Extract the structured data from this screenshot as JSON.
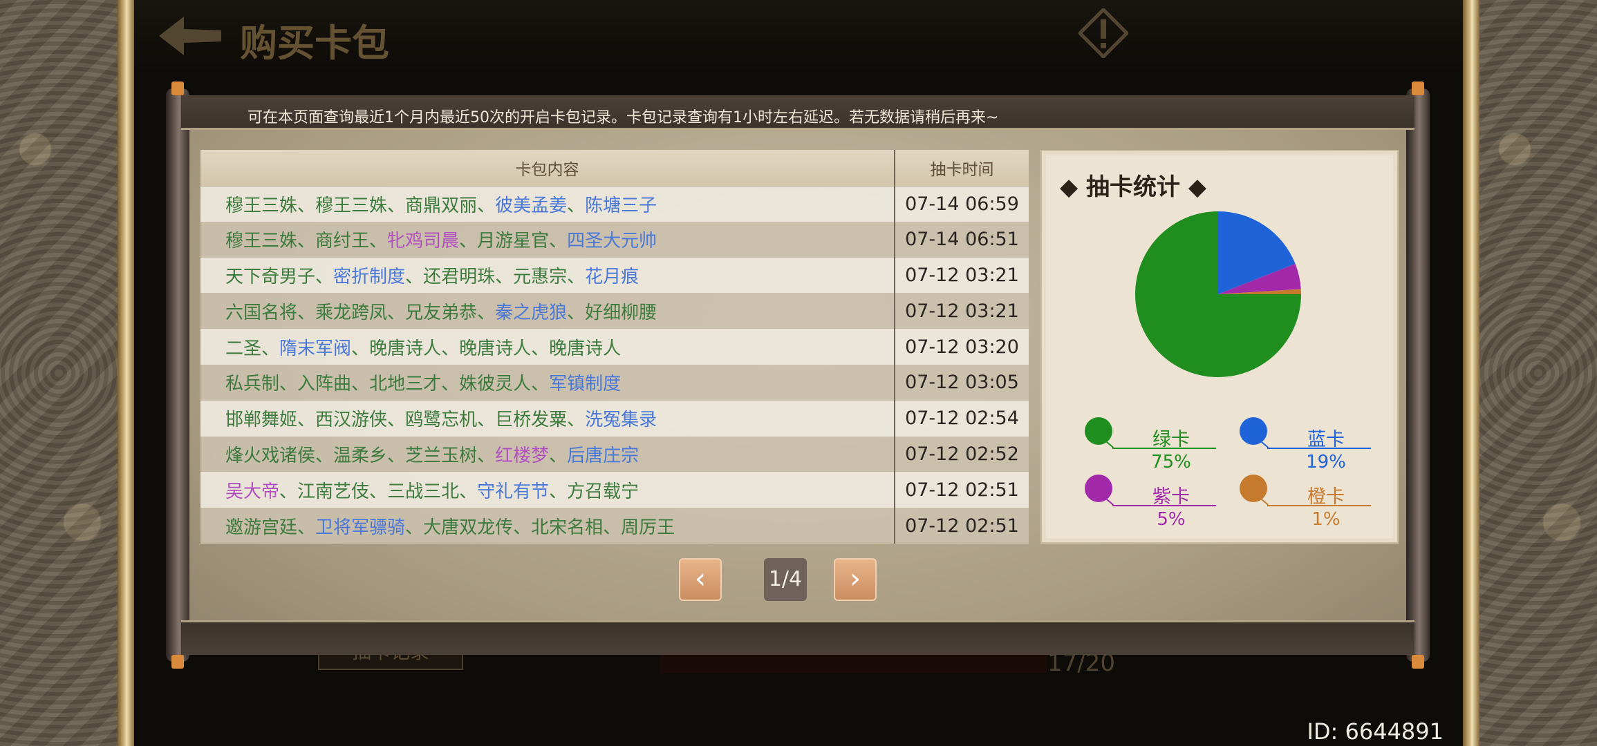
{
  "header": {
    "title": "购买卡包"
  },
  "notice": "可在本页面查询最近1个月内最近50次的开启卡包记录。卡包记录查询有1小时左右延迟。若无数据请稍后再来~",
  "table": {
    "col_content": "卡包内容",
    "col_time": "抽卡时间",
    "rows": [
      {
        "cards": [
          {
            "name": "穆王三姝",
            "color": "green"
          },
          {
            "name": "穆王三姝",
            "color": "green"
          },
          {
            "name": "商鼎双丽",
            "color": "green"
          },
          {
            "name": "彼美孟姜",
            "color": "blue"
          },
          {
            "name": "陈塘三子",
            "color": "blue"
          }
        ],
        "time": "07-14 06:59"
      },
      {
        "cards": [
          {
            "name": "穆王三姝",
            "color": "green"
          },
          {
            "name": "商纣王",
            "color": "green"
          },
          {
            "name": "牝鸡司晨",
            "color": "purple"
          },
          {
            "name": "月游星官",
            "color": "green"
          },
          {
            "name": "四圣大元帅",
            "color": "blue"
          }
        ],
        "time": "07-14 06:51"
      },
      {
        "cards": [
          {
            "name": "天下奇男子",
            "color": "green"
          },
          {
            "name": "密折制度",
            "color": "blue"
          },
          {
            "name": "还君明珠",
            "color": "green"
          },
          {
            "name": "元惠宗",
            "color": "green"
          },
          {
            "name": "花月痕",
            "color": "blue"
          }
        ],
        "time": "07-12 03:21"
      },
      {
        "cards": [
          {
            "name": "六国名将",
            "color": "green"
          },
          {
            "name": "乘龙跨凤",
            "color": "green"
          },
          {
            "name": "兄友弟恭",
            "color": "green"
          },
          {
            "name": "秦之虎狼",
            "color": "blue"
          },
          {
            "name": "好细柳腰",
            "color": "green"
          }
        ],
        "time": "07-12 03:21"
      },
      {
        "cards": [
          {
            "name": "二圣",
            "color": "green"
          },
          {
            "name": "隋末军阀",
            "color": "blue"
          },
          {
            "name": "晚唐诗人",
            "color": "green"
          },
          {
            "name": "晚唐诗人",
            "color": "green"
          },
          {
            "name": "晚唐诗人",
            "color": "green"
          }
        ],
        "time": "07-12 03:20"
      },
      {
        "cards": [
          {
            "name": "私兵制",
            "color": "green"
          },
          {
            "name": "入阵曲",
            "color": "green"
          },
          {
            "name": "北地三才",
            "color": "green"
          },
          {
            "name": "姝彼灵人",
            "color": "green"
          },
          {
            "name": "军镇制度",
            "color": "blue"
          }
        ],
        "time": "07-12 03:05"
      },
      {
        "cards": [
          {
            "name": "邯郸舞姬",
            "color": "green"
          },
          {
            "name": "西汉游侠",
            "color": "green"
          },
          {
            "name": "鸥鹭忘机",
            "color": "green"
          },
          {
            "name": "巨桥发粟",
            "color": "green"
          },
          {
            "name": "洗冤集录",
            "color": "blue"
          }
        ],
        "time": "07-12 02:54"
      },
      {
        "cards": [
          {
            "name": "烽火戏诸侯",
            "color": "green"
          },
          {
            "name": "温柔乡",
            "color": "green"
          },
          {
            "name": "芝兰玉树",
            "color": "green"
          },
          {
            "name": "红楼梦",
            "color": "purple"
          },
          {
            "name": "后唐庄宗",
            "color": "blue"
          }
        ],
        "time": "07-12 02:52"
      },
      {
        "cards": [
          {
            "name": "吴大帝",
            "color": "purple"
          },
          {
            "name": "江南艺伎",
            "color": "green"
          },
          {
            "name": "三战三北",
            "color": "green"
          },
          {
            "name": "守礼有节",
            "color": "blue"
          },
          {
            "name": "方召载宁",
            "color": "green"
          }
        ],
        "time": "07-12 02:51"
      },
      {
        "cards": [
          {
            "name": "邀游宫廷",
            "color": "green"
          },
          {
            "name": "卫将军骠骑",
            "color": "blue"
          },
          {
            "name": "大唐双龙传",
            "color": "green"
          },
          {
            "name": "北宋名相",
            "color": "green"
          },
          {
            "name": "周厉王",
            "color": "green"
          }
        ],
        "time": "07-12 02:51"
      }
    ]
  },
  "stats": {
    "title": "◆ 抽卡统计 ◆",
    "legend": [
      {
        "label": "绿卡",
        "pct": "75%",
        "color": "#1f8e1f"
      },
      {
        "label": "蓝卡",
        "pct": "19%",
        "color": "#1f63d8"
      },
      {
        "label": "紫卡",
        "pct": "5%",
        "color": "#a22aaa"
      },
      {
        "label": "橙卡",
        "pct": "1%",
        "color": "#c57a2e"
      }
    ]
  },
  "chart_data": {
    "type": "pie",
    "title": "抽卡统计",
    "categories": [
      "绿卡",
      "蓝卡",
      "紫卡",
      "橙卡"
    ],
    "values": [
      75,
      19,
      5,
      1
    ],
    "colors": [
      "#1f8e1f",
      "#1f63d8",
      "#a22aaa",
      "#c57a2e"
    ]
  },
  "pager": {
    "prev": "‹",
    "next": "›",
    "page": "1/4"
  },
  "background": {
    "tab_label": "抽卡记录",
    "count": "17/20"
  },
  "player_id": "ID: 6644891",
  "color_map": {
    "green": "#3d7a3d",
    "blue": "#4a78d8",
    "purple": "#b24fc0"
  }
}
